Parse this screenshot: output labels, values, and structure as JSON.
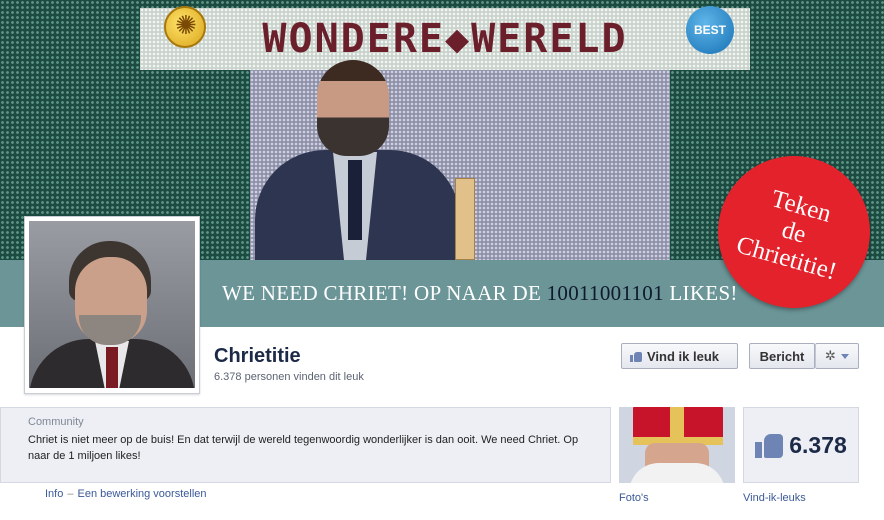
{
  "cover": {
    "title_text": "WONDERE◆WERELD",
    "logo_right": "BEST",
    "slogan_prefix": "WE NEED CHRIET! OP NAAR DE ",
    "slogan_number": "10011001101",
    "slogan_suffix": " LIKES!",
    "sticker": [
      "Teken",
      "de",
      "Chrietitie!"
    ]
  },
  "page": {
    "name": "Chrietitie",
    "likes_text": "6.378 personen vinden dit leuk"
  },
  "actions": {
    "like_label": "Vind ik leuk",
    "message_label": "Bericht",
    "gear_icon": "gear-icon"
  },
  "about": {
    "category": "Community",
    "description": "Chriet is niet meer op de buis! En dat terwijl de wereld tegenwoordig wonderlijker is dan ooit. We need Chriet. Op naar de 1 miljoen likes!",
    "info_link": "Info",
    "separator": "–",
    "edit_link": "Een bewerking voorstellen"
  },
  "tiles": {
    "photos_label": "Foto's",
    "likes_count": "6.378",
    "likes_label": "Vind-ik-leuks"
  },
  "colors": {
    "link": "#3b5998",
    "sticker": "#e3222b",
    "band": "#6b9597"
  }
}
